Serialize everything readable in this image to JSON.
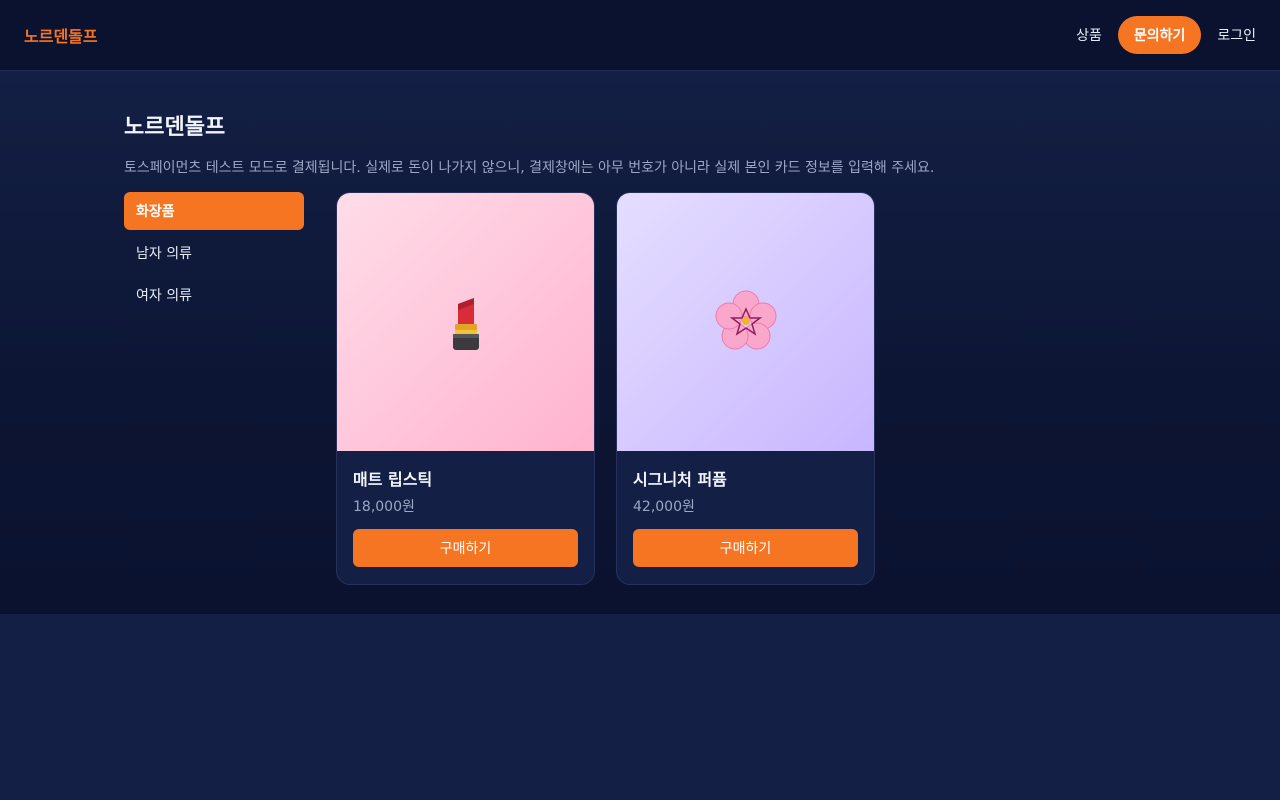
{
  "header": {
    "logo": "노르덴돌프",
    "nav": {
      "products": "상품",
      "contact": "문의하기",
      "login": "로그인"
    }
  },
  "main": {
    "title": "노르덴돌프",
    "notice": "토스페이먼츠 테스트 모드로 결제됩니다. 실제로 돈이 나가지 않으니, 결제창에는 아무 번호가 아니라 실제 본인 카드 정보를 입력해 주세요."
  },
  "sidebar": {
    "items": [
      {
        "label": "화장품",
        "active": true
      },
      {
        "label": "남자 의류",
        "active": false
      },
      {
        "label": "여자 의류",
        "active": false
      }
    ]
  },
  "products": [
    {
      "name": "매트 립스틱",
      "price": "18,000원",
      "button": "구매하기",
      "icon": "lipstick-icon"
    },
    {
      "name": "시그니처 퍼퓸",
      "price": "42,000원",
      "button": "구매하기",
      "icon": "flower-icon"
    }
  ],
  "colors": {
    "accent": "#f57522",
    "header_bg": "#0a1230",
    "page_bg": "#131f44"
  }
}
